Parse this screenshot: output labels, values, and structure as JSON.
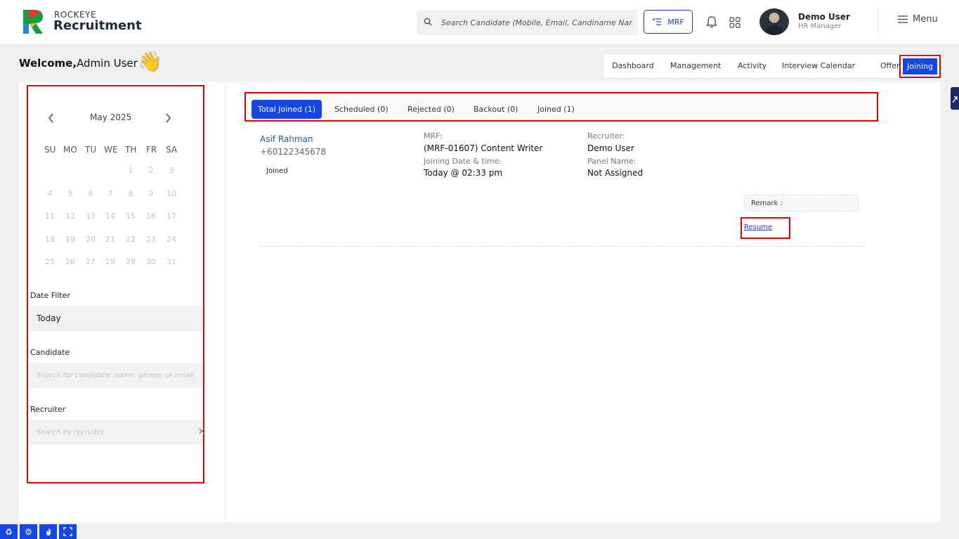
{
  "brand": {
    "top": "ROCKEYE",
    "main": "Recruitment"
  },
  "search": {
    "placeholder": "Search Candidate (Mobile, Email, Candiname Name)"
  },
  "header": {
    "mrf_label": "MRF",
    "user_name": "Demo User",
    "user_role": "HR Manager",
    "menu_label": "Menu"
  },
  "welcome": {
    "prefix": "Welcome,",
    "name": "Admin User",
    "emoji": "👋"
  },
  "nav": {
    "items": [
      "Dashboard",
      "Management",
      "Activity",
      "Interview Calendar",
      "Offer"
    ],
    "active": "Joining"
  },
  "calendar": {
    "month": "May 2025",
    "weekdays": [
      "SU",
      "MO",
      "TU",
      "WE",
      "TH",
      "FR",
      "SA"
    ],
    "weeks": [
      [
        "",
        "",
        "",
        "",
        "1",
        "2",
        "3"
      ],
      [
        "4",
        "5",
        "6",
        "7",
        "8",
        "9",
        "10"
      ],
      [
        "11",
        "12",
        "13",
        "14",
        "15",
        "16",
        "17"
      ],
      [
        "18",
        "19",
        "20",
        "21",
        "22",
        "23",
        "24"
      ],
      [
        "25",
        "26",
        "27",
        "28",
        "29",
        "30",
        "31"
      ]
    ]
  },
  "filters": {
    "date_label": "Date Filter",
    "date_value": "Today",
    "candidate_label": "Candidate",
    "candidate_placeholder": "Search for candidate: name, phone, or email",
    "recruiter_label": "Recruiter",
    "recruiter_placeholder": "Search by recruiter",
    "clear": "✕"
  },
  "tabs": [
    {
      "label": "Total Joined (1)",
      "active": true
    },
    {
      "label": "Scheduled (0)",
      "active": false
    },
    {
      "label": "Rejected (0)",
      "active": false
    },
    {
      "label": "Backout (0)",
      "active": false
    },
    {
      "label": "Joined (1)",
      "active": false
    }
  ],
  "candidate": {
    "name": "Asif Rahman",
    "phone": "+60122345678",
    "status": "Joined",
    "mrf_label": "MRF:",
    "mrf_value": "(MRF-01607) Content Writer",
    "joining_label": "Joining Date & time:",
    "joining_value": "Today @ 02:33 pm",
    "recruiter_label": "Recruiter:",
    "recruiter_value": "Demo User",
    "panel_label": "Panel Name:",
    "panel_value": "Not Assigned",
    "remark_label": "Remark :",
    "resume_link": "Resume"
  },
  "colors": {
    "primary": "#1447e6",
    "highlight": "#e00000",
    "link": "#1a55c8"
  },
  "bottom_icons": [
    "recycle-icon",
    "settings-icon",
    "fire-icon",
    "expand-icon"
  ]
}
